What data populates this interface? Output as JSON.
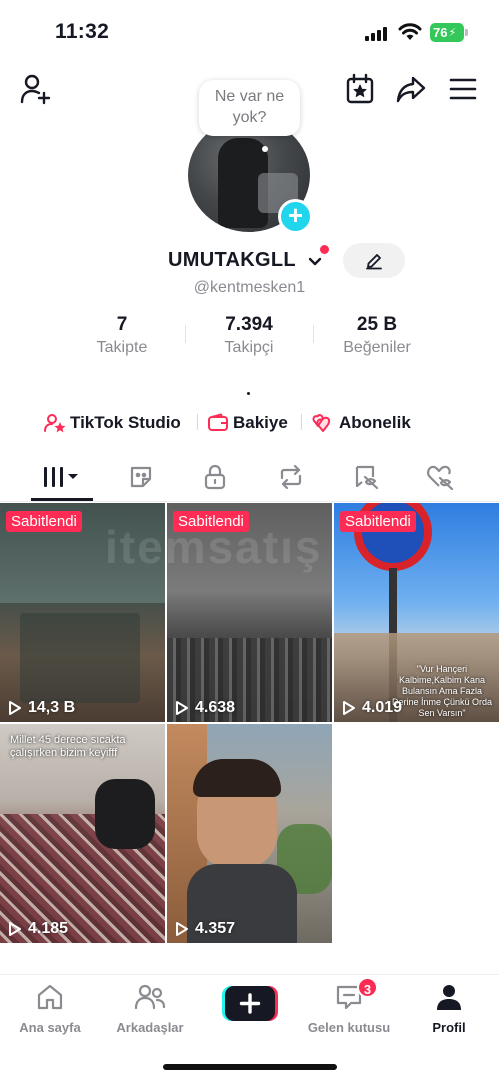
{
  "status_bar": {
    "time": "11:32",
    "battery": "76"
  },
  "profile": {
    "note_bubble": "Ne var ne yok?",
    "username": "UMUTAKGLL",
    "handle": "@kentmesken1",
    "stats": [
      {
        "value": "7",
        "label": "Takipte"
      },
      {
        "value": "7.394",
        "label": "Takipçi"
      },
      {
        "value": "25 B",
        "label": "Beğeniler"
      }
    ],
    "bio": "."
  },
  "links": {
    "studio": "TikTok Studio",
    "balance": "Bakiye",
    "subscription": "Abonelik"
  },
  "tabs": [
    "videos",
    "favorites-sticker",
    "private",
    "reposts",
    "tagged",
    "liked"
  ],
  "watermark": "itemsatış",
  "videos": [
    {
      "pinned": "Sabitlendi",
      "views": "14,3 B",
      "caption": ""
    },
    {
      "pinned": "Sabitlendi",
      "views": "4.638",
      "caption": ""
    },
    {
      "pinned": "Sabitlendi",
      "views": "4.019",
      "caption": "\"Vur Hançeri Kalbime,Kalbim Kana Bulansın Ama Fazla Derine İnme Çünkü Orda Sen Varsın\""
    },
    {
      "pinned": "",
      "views": "4.185",
      "caption": "Millet 45 derece sıcakta çalışırken bizim keyifff"
    },
    {
      "pinned": "",
      "views": "4.357",
      "caption": ""
    }
  ],
  "bottom_nav": {
    "home": "Ana sayfa",
    "friends": "Arkadaşlar",
    "inbox": "Gelen kutusu",
    "inbox_badge": "3",
    "profile": "Profil"
  }
}
